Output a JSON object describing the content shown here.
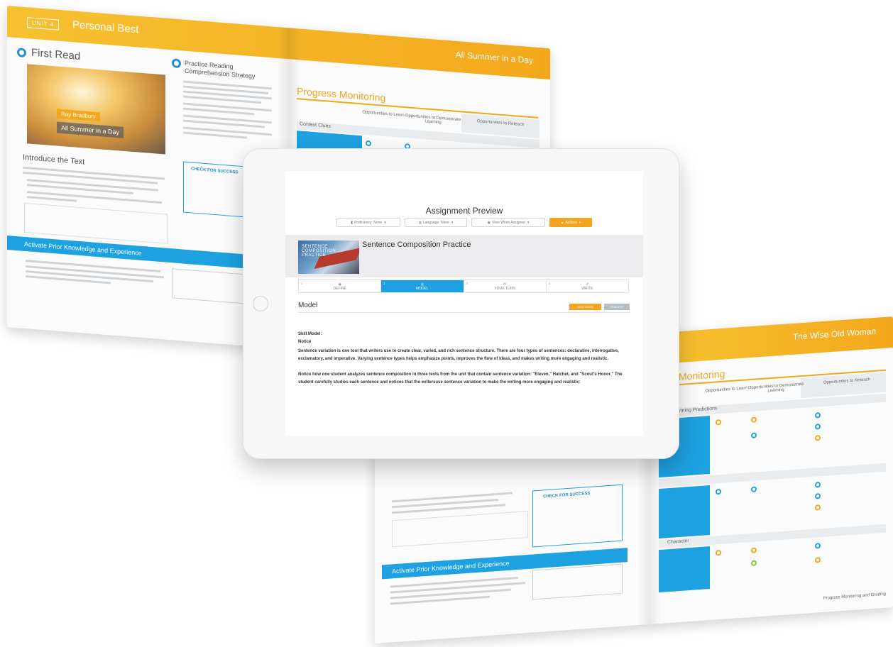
{
  "book_left": {
    "unit_tag": "UNIT 4",
    "unit_title": "Personal Best",
    "right_header": "All Summer in a Day",
    "first_read": "First Read",
    "cover_author": "Ray Bradbury",
    "cover_title": "All Summer in a Day",
    "introduce": "Introduce the Text",
    "practice_title": "Practice Reading Comprehension Strategy",
    "check_success": "CHECK FOR SUCCESS",
    "activate": "Activate Prior Knowledge and Experience",
    "progress_title": "Progress Monitoring",
    "col_learn": "Opportunities to Learn",
    "col_demo": "Opportunities to Demonstrate Learning",
    "col_reteach": "Opportunities to Reteach",
    "row_label": "Context Clues"
  },
  "book_right": {
    "right_header": "The Wise Old Woman",
    "progress_title": "Monitoring",
    "col_learn": "Opportunities to Learn",
    "col_demo": "Opportunities to Demonstrate Learning",
    "col_reteach": "Opportunities to Reteach",
    "row1": "Confirming Predictions",
    "row3": "Character",
    "check_success": "CHECK FOR SUCCESS",
    "activate": "Activate Prior Knowledge and Experience",
    "footer": "Progress Monitoring and Grading"
  },
  "tablet": {
    "title": "Assignment Preview",
    "toolbar": {
      "proficiency": "Proficiency: None",
      "language": "Language: None",
      "view": "View When Assigned",
      "actions": "Actions"
    },
    "lesson": {
      "title": "Sentence Composition Practice",
      "thumb_text": "SENTENCE COMPOSITION PRACTICE"
    },
    "steps": [
      {
        "num": "1",
        "icon": "◉",
        "label": "DEFINE"
      },
      {
        "num": "2",
        "icon": "◎",
        "label": "MODEL"
      },
      {
        "num": "3",
        "icon": "⟳",
        "label": "YOUR TURN"
      },
      {
        "num": "4",
        "icon": "✐",
        "label": "WRITE"
      }
    ],
    "section_heading": "Model",
    "annotation_btn": "ANNOTATION",
    "highlight_btn": "HIGHLIGHT",
    "skill_model": "Skill Model:",
    "notice": "Notice",
    "para1": "Sentence variation is one tool that writers use to create clear, varied, and rich sentence structure. There are four types of sentences: declarative, interrogative, exclamatory, and imperative. Varying sentence types helps emphasize points, improves the flow of ideas, and makes writing more engaging and realistic.",
    "para2": "Notice how one student analyzes sentence composition in three texts from the unit that contain sentence variation: \"Eleven,\" Hatchet, and \"Scout's Honor.\" The student carefully studies each sentence and notices that the writersuse sentence variation to make the writing more engaging and realistic:"
  }
}
